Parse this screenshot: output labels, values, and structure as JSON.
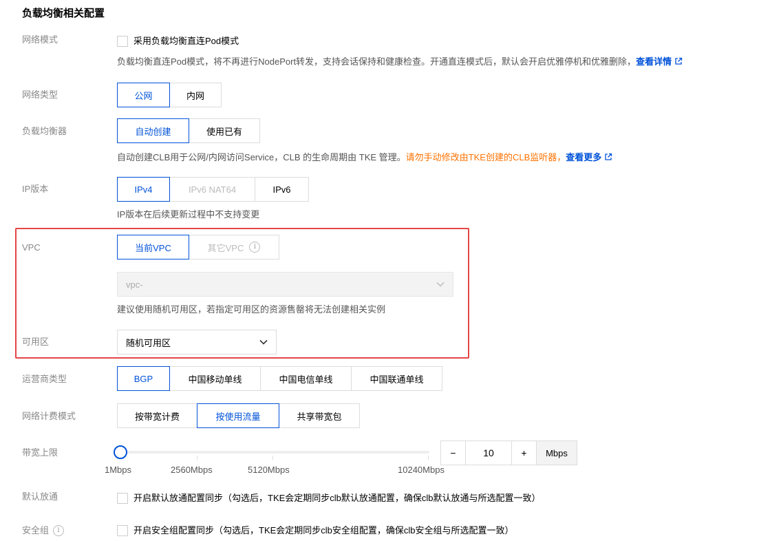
{
  "section_title": "负载均衡相关配置",
  "network_mode": {
    "label": "网络模式",
    "checkbox_label": "采用负载均衡直连Pod模式",
    "checked": false,
    "desc": "负载均衡直连Pod模式，将不再进行NodePort转发，支持会话保持和健康检查。开通直连模式后，默认会开启优雅停机和优雅删除，",
    "link": "查看详情"
  },
  "network_type": {
    "label": "网络类型",
    "options": [
      "公网",
      "内网"
    ],
    "selected": "公网"
  },
  "load_balancer": {
    "label": "负载均衡器",
    "options": [
      "自动创建",
      "使用已有"
    ],
    "selected": "自动创建",
    "desc": "自动创建CLB用于公网/内网访问Service，CLB 的生命周期由 TKE 管理。",
    "warning": "请勿手动修改由TKE创建的CLB监听器，",
    "link": "查看更多"
  },
  "ip_version": {
    "label": "IP版本",
    "options": [
      "IPv4",
      "IPv6 NAT64",
      "IPv6"
    ],
    "selected": "IPv4",
    "disabled": [
      "IPv6 NAT64"
    ],
    "desc": "IP版本在后续更新过程中不支持变更"
  },
  "vpc": {
    "label": "VPC",
    "options": [
      "当前VPC",
      "其它VPC"
    ],
    "selected": "当前VPC",
    "select_value": "vpc-",
    "desc": "建议使用随机可用区，若指定可用区的资源售罄将无法创建相关实例"
  },
  "zone": {
    "label": "可用区",
    "value": "随机可用区"
  },
  "isp_type": {
    "label": "运营商类型",
    "options": [
      "BGP",
      "中国移动单线",
      "中国电信单线",
      "中国联通单线"
    ],
    "selected": "BGP"
  },
  "billing_mode": {
    "label": "网络计费模式",
    "options": [
      "按带宽计费",
      "按使用流量",
      "共享带宽包"
    ],
    "selected": "按使用流量"
  },
  "bandwidth": {
    "label": "带宽上限",
    "ticks": [
      "1Mbps",
      "2560Mbps",
      "5120Mbps",
      "10240Mbps"
    ],
    "value": "10",
    "minus": "−",
    "plus": "+",
    "unit": "Mbps"
  },
  "default_allow": {
    "label": "默认放通",
    "checkbox_label": "开启默认放通配置同步（勾选后，TKE会定期同步clb默认放通配置，确保clb默认放通与所选配置一致）",
    "checked": false
  },
  "security_group": {
    "label": "安全组",
    "checkbox_label": "开启安全组配置同步（勾选后，TKE会定期同步clb安全组配置，确保clb安全组与所选配置一致）",
    "checked": false
  },
  "colors": {
    "primary": "#0052d9",
    "warning": "#ff7200",
    "highlight_border": "#e54545"
  }
}
